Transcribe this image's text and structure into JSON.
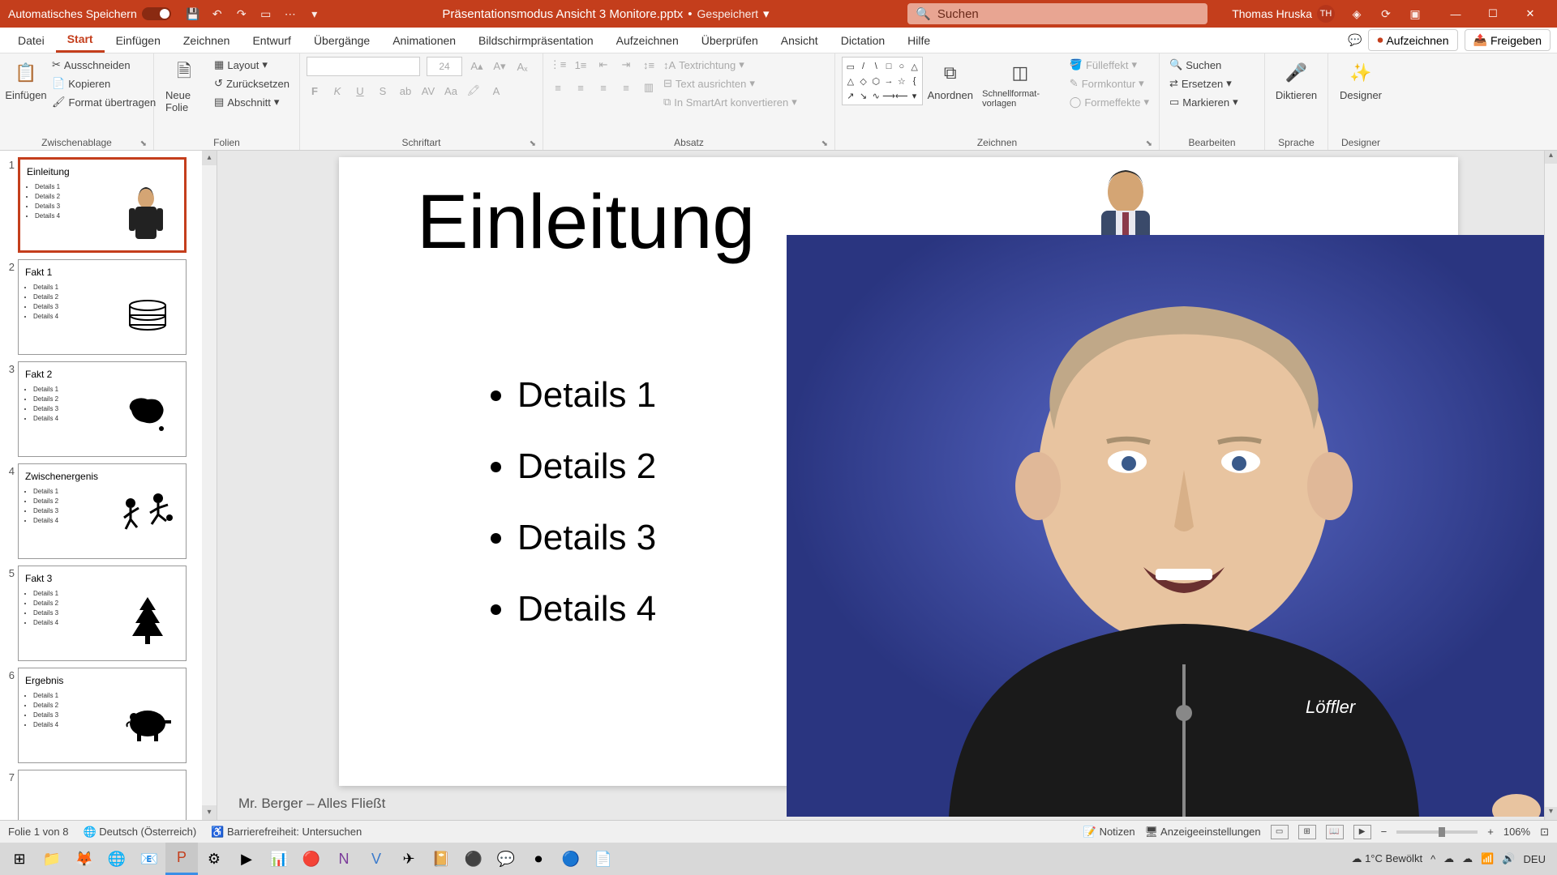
{
  "titlebar": {
    "autosave_label": "Automatisches Speichern",
    "filename": "Präsentationsmodus Ansicht 3 Monitore.pptx",
    "saved_state": "Gespeichert",
    "search_placeholder": "Suchen",
    "account_name": "Thomas Hruska",
    "account_initials": "TH"
  },
  "tabs": {
    "datei": "Datei",
    "start": "Start",
    "einfuegen": "Einfügen",
    "zeichnen": "Zeichnen",
    "entwurf": "Entwurf",
    "uebergaenge": "Übergänge",
    "animationen": "Animationen",
    "bildschirm": "Bildschirmpräsentation",
    "aufzeichnen": "Aufzeichnen",
    "ueberpruefen": "Überprüfen",
    "ansicht": "Ansicht",
    "dictation": "Dictation",
    "hilfe": "Hilfe",
    "record_btn": "Aufzeichnen",
    "share_btn": "Freigeben"
  },
  "ribbon": {
    "paste": "Einfügen",
    "cut": "Ausschneiden",
    "copy": "Kopieren",
    "format_painter": "Format übertragen",
    "clipboard_label": "Zwischenablage",
    "new_slide": "Neue Folie",
    "layout": "Layout",
    "reset": "Zurücksetzen",
    "section": "Abschnitt",
    "slides_label": "Folien",
    "font_label": "Schriftart",
    "font_size": "24",
    "paragraph_label": "Absatz",
    "text_direction": "Textrichtung",
    "align_text": "Text ausrichten",
    "smartart": "In SmartArt konvertieren",
    "arrange": "Anordnen",
    "quick_styles": "Schnellformat-vorlagen",
    "shape_fill": "Fülleffekt",
    "shape_outline": "Formkontur",
    "shape_effects": "Formeffekte",
    "drawing_label": "Zeichnen",
    "find": "Suchen",
    "replace": "Ersetzen",
    "select": "Markieren",
    "editing_label": "Bearbeiten",
    "dictate": "Diktieren",
    "voice_label": "Sprache",
    "designer": "Designer",
    "designer_label": "Designer"
  },
  "thumbnails": [
    {
      "n": "1",
      "title": "Einleitung",
      "bullets": [
        "Details 1",
        "Details 2",
        "Details 3",
        "Details 4"
      ],
      "icon": "person"
    },
    {
      "n": "2",
      "title": "Fakt 1",
      "bullets": [
        "Details 1",
        "Details 2",
        "Details 3",
        "Details 4"
      ],
      "icon": "books"
    },
    {
      "n": "3",
      "title": "Fakt 2",
      "bullets": [
        "Details 1",
        "Details 2",
        "Details 3",
        "Details 4"
      ],
      "icon": "australia"
    },
    {
      "n": "4",
      "title": "Zwischenergenis",
      "bullets": [
        "Details 1",
        "Details 2",
        "Details 3",
        "Details 4"
      ],
      "icon": "soccer"
    },
    {
      "n": "5",
      "title": "Fakt 3",
      "bullets": [
        "Details 1",
        "Details 2",
        "Details 3",
        "Details 4"
      ],
      "icon": "tree"
    },
    {
      "n": "6",
      "title": "Ergebnis",
      "bullets": [
        "Details 1",
        "Details 2",
        "Details 3",
        "Details 4"
      ],
      "icon": "pig"
    },
    {
      "n": "7",
      "title": "",
      "bullets": [],
      "icon": ""
    }
  ],
  "slide": {
    "title": "Einleitung",
    "bullets": [
      "Details 1",
      "Details 2",
      "Details 3",
      "Details 4"
    ],
    "footer": "Mr. Berger – Alles Fließt"
  },
  "statusbar": {
    "slide_count": "Folie 1 von 8",
    "language": "Deutsch (Österreich)",
    "accessibility": "Barrierefreiheit: Untersuchen",
    "notes": "Notizen",
    "display_settings": "Anzeigeeinstellungen",
    "zoom": "106%"
  },
  "taskbar": {
    "weather_temp": "1°C",
    "weather_text": "Bewölkt",
    "lang": "DEU"
  }
}
